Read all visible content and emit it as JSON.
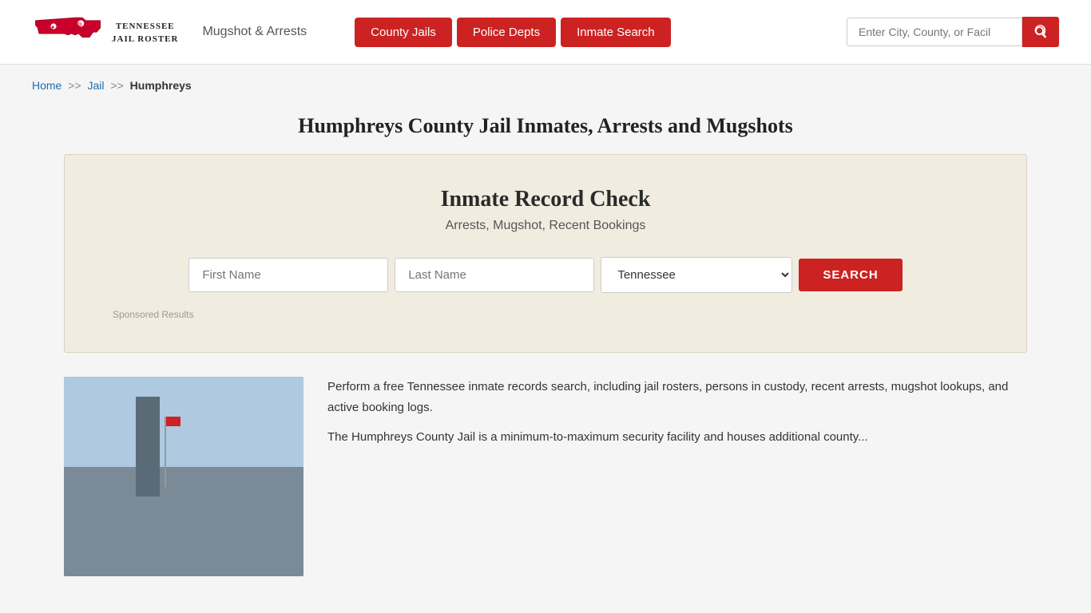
{
  "header": {
    "logo_line1": "TENNESSEE",
    "logo_line2": "JAIL ROSTER",
    "nav_text": "Mugshot & Arrests",
    "buttons": [
      {
        "label": "County Jails",
        "id": "county-jails"
      },
      {
        "label": "Police Depts",
        "id": "police-depts"
      },
      {
        "label": "Inmate Search",
        "id": "inmate-search"
      }
    ],
    "search_placeholder": "Enter City, County, or Facil"
  },
  "breadcrumb": {
    "home": "Home",
    "sep1": ">>",
    "jail": "Jail",
    "sep2": ">>",
    "current": "Humphreys"
  },
  "page": {
    "title": "Humphreys County Jail Inmates, Arrests and Mugshots"
  },
  "record_check": {
    "heading": "Inmate Record Check",
    "subtitle": "Arrests, Mugshot, Recent Bookings",
    "first_name_placeholder": "First Name",
    "last_name_placeholder": "Last Name",
    "state_default": "Tennessee",
    "search_btn": "SEARCH",
    "sponsored_label": "Sponsored Results"
  },
  "content": {
    "paragraph1": "Perform a free Tennessee inmate records search, including jail rosters, persons in custody, recent arrests, mugshot lookups, and active booking logs.",
    "paragraph2": "The Humphreys County Jail is a minimum-to-maximum security facility and houses additional county..."
  }
}
